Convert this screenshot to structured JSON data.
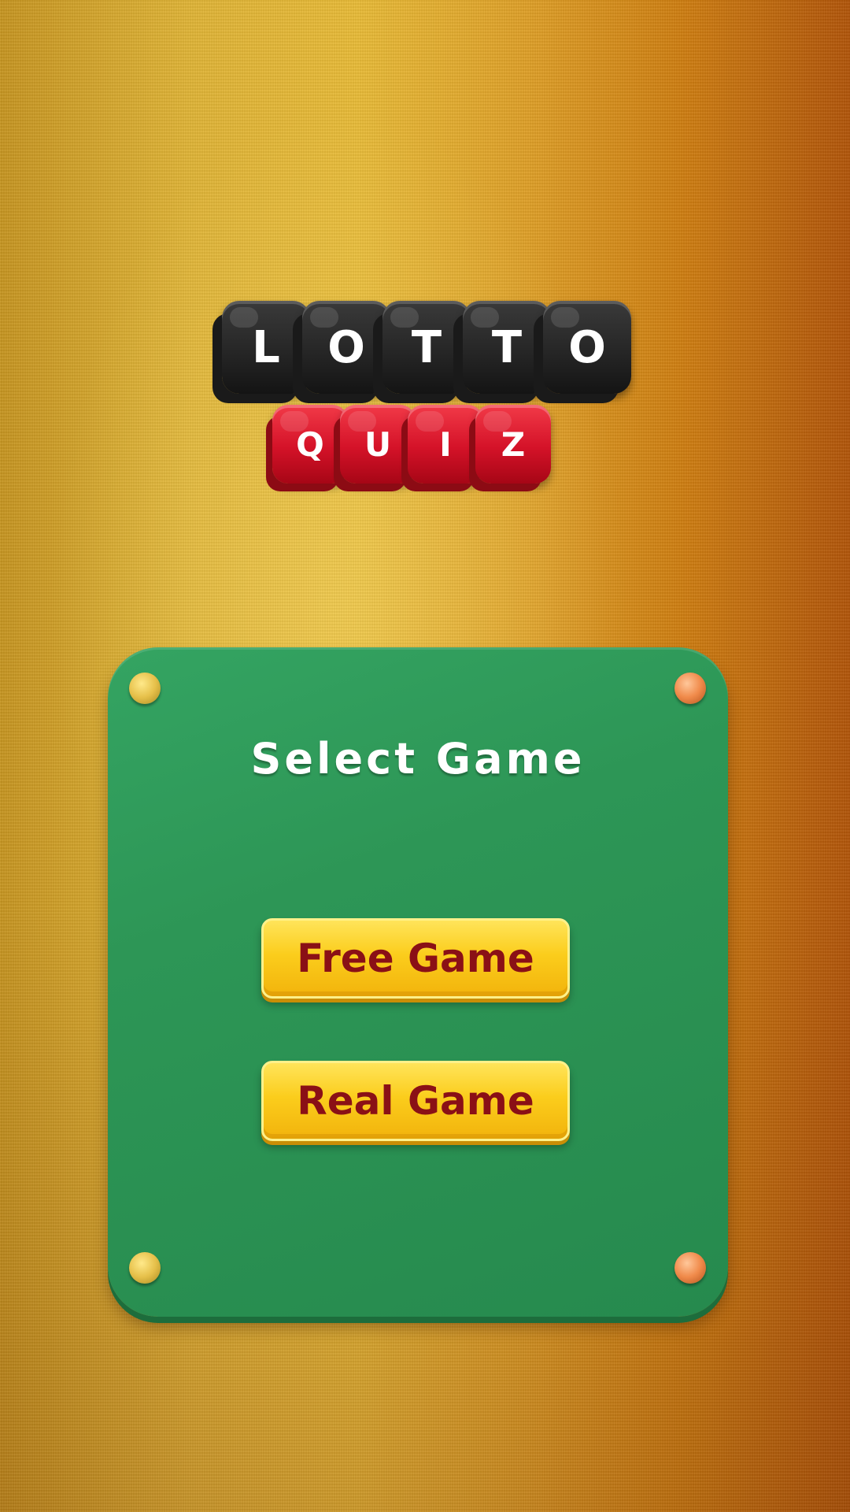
{
  "logo": {
    "line1": [
      "L",
      "O",
      "T",
      "T",
      "O"
    ],
    "line2": [
      "Q",
      "U",
      "I",
      "Z"
    ]
  },
  "panel": {
    "title": "Select Game",
    "buttons": {
      "free": "Free Game",
      "real": "Real Game"
    }
  },
  "colors": {
    "panel_green": "#2d9656",
    "button_yellow": "#fbcd1c",
    "button_text": "#8a1016",
    "tile_black": "#262626",
    "tile_red": "#d41228"
  }
}
